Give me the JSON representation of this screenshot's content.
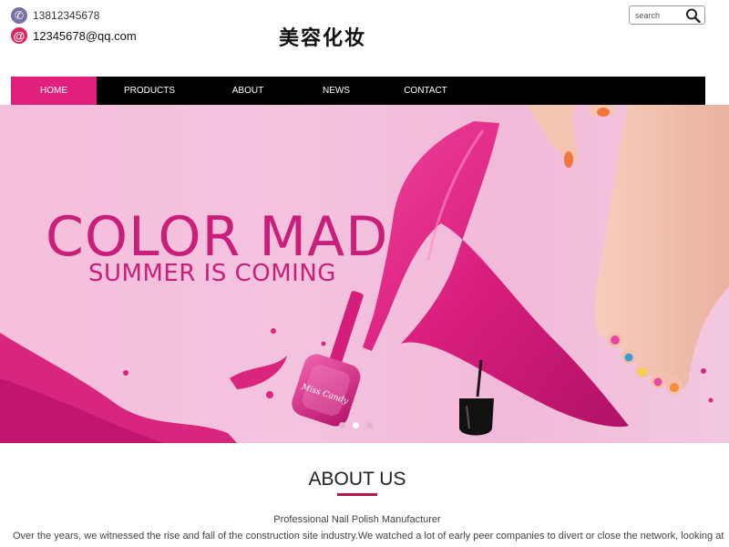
{
  "header": {
    "phone": "13812345678",
    "email": "12345678@qq.com",
    "logo_text": "美容化妆",
    "search_placeholder": "search",
    "icons": {
      "phone": "phone-icon",
      "email": "at-sign-icon",
      "search": "magnifier-icon"
    }
  },
  "nav": {
    "items": [
      {
        "label": "HOME",
        "active": true
      },
      {
        "label": "PRODUCTS",
        "active": false
      },
      {
        "label": "ABOUT",
        "active": false
      },
      {
        "label": "NEWS",
        "active": false
      },
      {
        "label": "CONTACT",
        "active": false
      }
    ]
  },
  "banner": {
    "title": "COLOR MAD",
    "subtitle": "SUMMER IS COMING",
    "bottle_label": "Miss Candy",
    "slide_count": 3,
    "active_slide": 2
  },
  "about": {
    "title": "ABOUT US",
    "subtitle": "Professional Nail Polish Manufacturer",
    "text": "Over the years, we witnessed the rise and fall of the construction site industry.We watched a lot of early peer companies to divert or close the network, looking at there"
  },
  "colors": {
    "accent": "#e0207a",
    "nav_bg": "#000000",
    "brand_pink": "#c91f7b",
    "underline": "#b0184f"
  }
}
